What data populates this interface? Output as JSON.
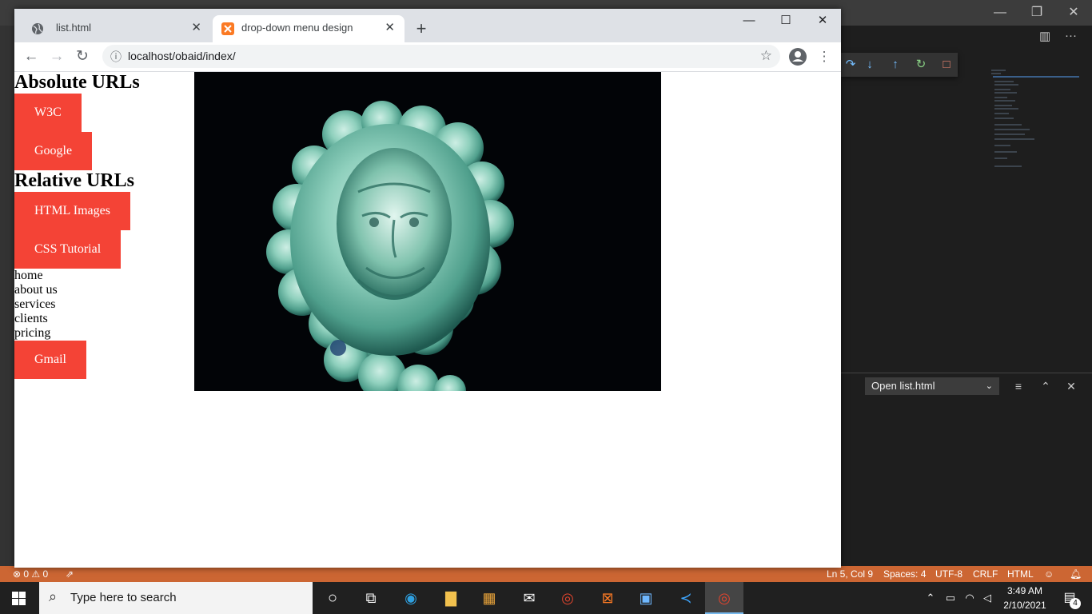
{
  "chrome": {
    "tabs": [
      {
        "title": "list.html"
      },
      {
        "title": "drop-down menu design"
      }
    ],
    "url": "localhost/obaid/index/"
  },
  "page": {
    "absolute_heading": "Absolute URLs",
    "absolute_links": [
      "W3C",
      "Google"
    ],
    "relative_heading": "Relative URLs",
    "relative_links": [
      "HTML Images",
      "CSS Tutorial"
    ],
    "menu": [
      "home",
      "about us",
      "services",
      "clients",
      "pricing"
    ],
    "gmail_label": "Gmail"
  },
  "vscode": {
    "panel_select": "Open list.html",
    "status": {
      "problems": "⊗ 0 ⚠ 0",
      "position": "Ln 5, Col 9",
      "spaces": "Spaces: 4",
      "encoding": "UTF-8",
      "eol": "CRLF",
      "language": "HTML"
    },
    "accent": "#cc6633"
  },
  "taskbar": {
    "search_placeholder": "Type here to search",
    "time": "3:49 AM",
    "date": "2/10/2021",
    "notification_count": "4"
  }
}
